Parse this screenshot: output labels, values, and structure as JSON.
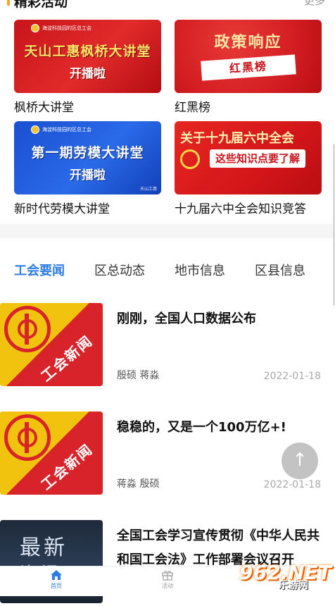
{
  "section": {
    "title": "精彩活动",
    "more": "更多"
  },
  "activities": [
    {
      "caption": "枫桥大讲堂",
      "org": "海淀科技园的区总工会",
      "line1": "天山工惠枫桥大讲堂",
      "line2": "开播啦"
    },
    {
      "caption": "红黑榜",
      "line1": "政策响应",
      "line2": "红黑榜"
    },
    {
      "caption": "新时代劳模大讲堂",
      "org": "海淀科技园的区总工会",
      "line1": "第一期劳模大讲堂",
      "line2": "开播啦",
      "stamp": "天山工惠"
    },
    {
      "caption": "十九届六中全会知识竞答",
      "line1": "关于十九届六中全会",
      "line2": "这些知识点要了解"
    }
  ],
  "tabs": [
    "工会要闻",
    "区总动态",
    "地市信息",
    "区县信息"
  ],
  "news": [
    {
      "title": "刚刚，全国人口数据公布",
      "authors": "殷硕 蒋淼",
      "date": "2022-01-18",
      "thumb_text": "工会新闻"
    },
    {
      "title": "稳稳的，又是一个100万亿+!",
      "authors": "蒋淼 殷硕",
      "date": "2022-01-18",
      "thumb_text": "工会新闻"
    },
    {
      "title": "全国工会学习宣传贯彻《中华人民共和国工会法》工作部署会议召开",
      "thumb_text1": "最新",
      "thumb_text2": "资讯"
    }
  ],
  "fab_icon": "↑",
  "bottom_nav": [
    {
      "label": "首页",
      "icon": "home-icon"
    },
    {
      "label": "活动",
      "icon": "gift-icon"
    }
  ],
  "watermark": {
    "main": "962.NET",
    "sub": "乐游网"
  },
  "colors": {
    "accent": "#2f7de1",
    "section_bar": "#f5a623"
  }
}
